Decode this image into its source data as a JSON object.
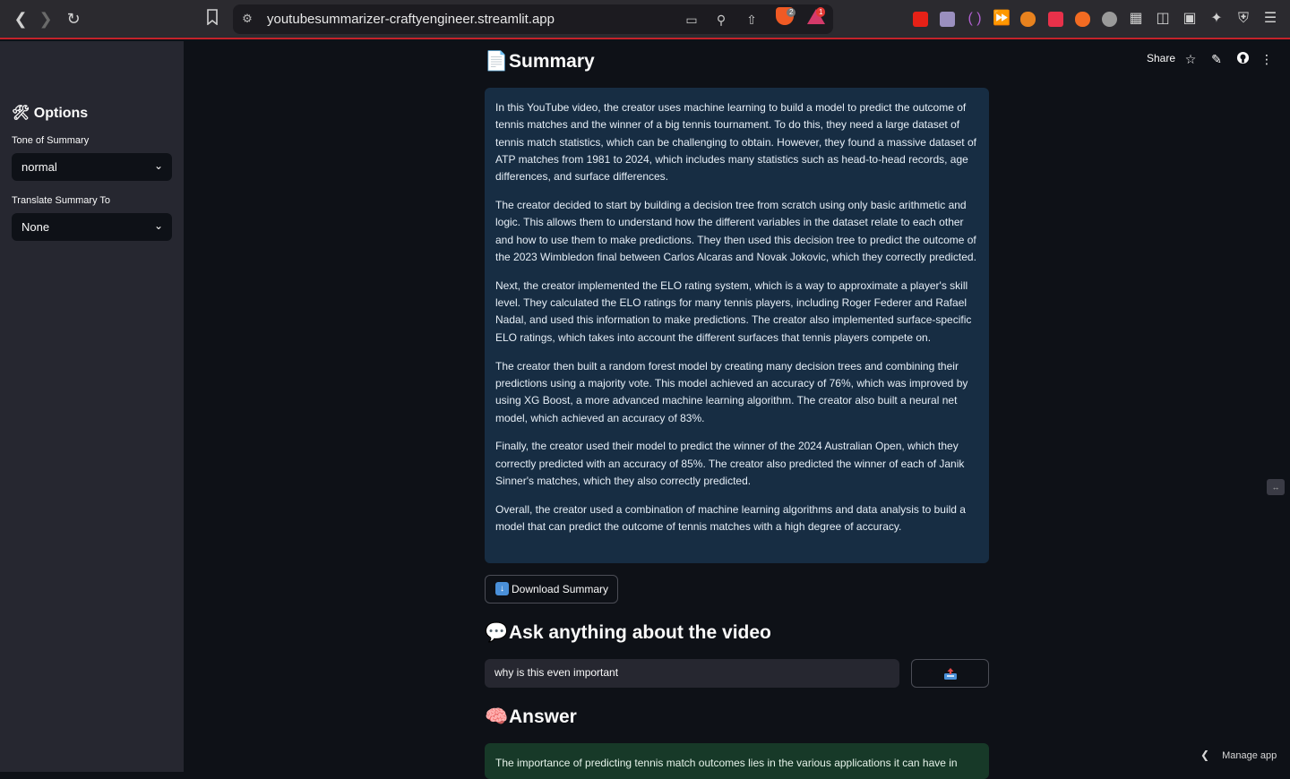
{
  "browser": {
    "url": "youtubesummarizer-craftyengineer.streamlit.app",
    "brave_badge": "2",
    "alert_badge": "1",
    "icons": [
      "back-icon",
      "forward-icon",
      "reload-icon",
      "bookmark-icon",
      "site-settings-icon",
      "cast-icon",
      "zoom-icon",
      "share-icon",
      "extensions-icon",
      "sidebar-icon",
      "wallet-icon",
      "leo-ai-icon",
      "vpn-icon",
      "menu-icon"
    ]
  },
  "sidebar": {
    "title": "Options",
    "title_icon": "tools-icon",
    "tone": {
      "label": "Tone of Summary",
      "value": "normal"
    },
    "translate": {
      "label": "Translate Summary To",
      "value": "None"
    }
  },
  "header": {
    "share_label": "Share",
    "icons": [
      "star-icon",
      "edit-icon",
      "github-icon",
      "more-icon"
    ]
  },
  "summary": {
    "title": "Summary",
    "title_icon": "page-icon",
    "paragraphs": [
      "In this YouTube video, the creator uses machine learning to build a model to predict the outcome of tennis matches and the winner of a big tennis tournament. To do this, they need a large dataset of tennis match statistics, which can be challenging to obtain. However, they found a massive dataset of ATP matches from 1981 to 2024, which includes many statistics such as head-to-head records, age differences, and surface differences.",
      "The creator decided to start by building a decision tree from scratch using only basic arithmetic and logic. This allows them to understand how the different variables in the dataset relate to each other and how to use them to make predictions. They then used this decision tree to predict the outcome of the 2023 Wimbledon final between Carlos Alcaras and Novak Jokovic, which they correctly predicted.",
      "Next, the creator implemented the ELO rating system, which is a way to approximate a player's skill level. They calculated the ELO ratings for many tennis players, including Roger Federer and Rafael Nadal, and used this information to make predictions. The creator also implemented surface-specific ELO ratings, which takes into account the different surfaces that tennis players compete on.",
      "The creator then built a random forest model by creating many decision trees and combining their predictions using a majority vote. This model achieved an accuracy of 76%, which was improved by using XG Boost, a more advanced machine learning algorithm. The creator also built a neural net model, which achieved an accuracy of 83%.",
      "Finally, the creator used their model to predict the winner of the 2024 Australian Open, which they correctly predicted with an accuracy of 85%. The creator also predicted the winner of each of Janik Sinner's matches, which they also correctly predicted.",
      "Overall, the creator used a combination of machine learning algorithms and data analysis to build a model that can predict the outcome of tennis matches with a high degree of accuracy."
    ],
    "download_label": "Download Summary"
  },
  "ask": {
    "title": "Ask anything about the video",
    "title_icon": "speech-bubble-icon",
    "input_value": "why is this even important",
    "send_icon": "outbox-tray-icon"
  },
  "answer": {
    "title": "Answer",
    "title_icon": "brain-icon",
    "text": "The importance of predicting tennis match outcomes lies in the various applications it can have in"
  },
  "footer": {
    "manage_label": "Manage app"
  },
  "colors": {
    "app_bg": "#0e1117",
    "sidebar_bg": "#262730",
    "info_bg": "#172d43",
    "success_bg": "#173928",
    "browser_accent": "#c4222a"
  }
}
